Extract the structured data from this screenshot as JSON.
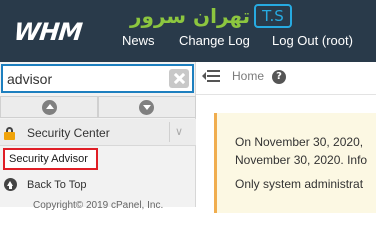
{
  "header": {
    "logo": "WHM",
    "brand_overlay": {
      "script_text": "ﺗﻬﺮاﻥ ﺳﺮﻭﺭ",
      "box_text": "T.S"
    },
    "nav": {
      "news": "News",
      "change_log": "Change Log",
      "log_out": "Log Out (root)"
    }
  },
  "sidebar": {
    "search": {
      "value": "advisor",
      "clear_icon": "close-icon"
    },
    "collapse_controls": {
      "up_icon": "chevron-up-icon",
      "down_icon": "chevron-down-icon"
    },
    "category": {
      "label": "Security Center",
      "icon": "lock-icon",
      "chevron": "∨"
    },
    "items": [
      {
        "label": "Security Advisor",
        "highlighted": true
      }
    ],
    "back_to_top": "Back To Top",
    "copyright": "Copyright© 2019 cPanel, Inc."
  },
  "breadcrumb": {
    "menu_icon": "menu-collapse-icon",
    "home": "Home",
    "help_icon": "?"
  },
  "main": {
    "notice": {
      "line1": "On November 30, 2020,",
      "line2": "November 30, 2020. Info",
      "line3": "Only system administrat"
    }
  },
  "colors": {
    "header_bg": "#293a4a",
    "accent_blue": "#1d7fbf",
    "highlight_red": "#e01e26",
    "notice_bg": "#fcf8e3",
    "notice_border": "#f0ad4e",
    "brand_green": "#8cc63f",
    "brand_blue": "#27aae1"
  }
}
